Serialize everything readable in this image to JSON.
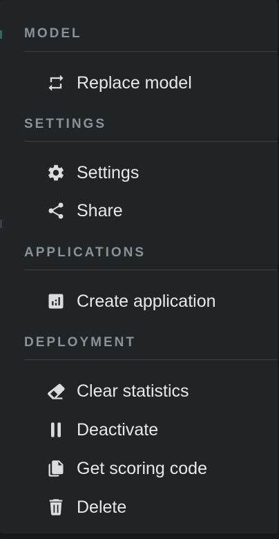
{
  "menu": {
    "sections": [
      {
        "header": "MODEL",
        "items": [
          {
            "label": "Replace model",
            "icon": "replace-icon"
          }
        ]
      },
      {
        "header": "SETTINGS",
        "items": [
          {
            "label": "Settings",
            "icon": "gear-icon"
          },
          {
            "label": "Share",
            "icon": "share-icon"
          }
        ]
      },
      {
        "header": "APPLICATIONS",
        "items": [
          {
            "label": "Create application",
            "icon": "chart-app-icon"
          }
        ]
      },
      {
        "header": "DEPLOYMENT",
        "items": [
          {
            "label": "Clear statistics",
            "icon": "eraser-icon"
          },
          {
            "label": "Deactivate",
            "icon": "pause-icon"
          },
          {
            "label": "Get scoring code",
            "icon": "copy-icon"
          },
          {
            "label": "Delete",
            "icon": "trash-icon"
          }
        ]
      }
    ]
  },
  "colors": {
    "background": "#202426",
    "header_text": "#8b9296",
    "item_text": "#e6e9eb",
    "divider": "#3a4043"
  }
}
